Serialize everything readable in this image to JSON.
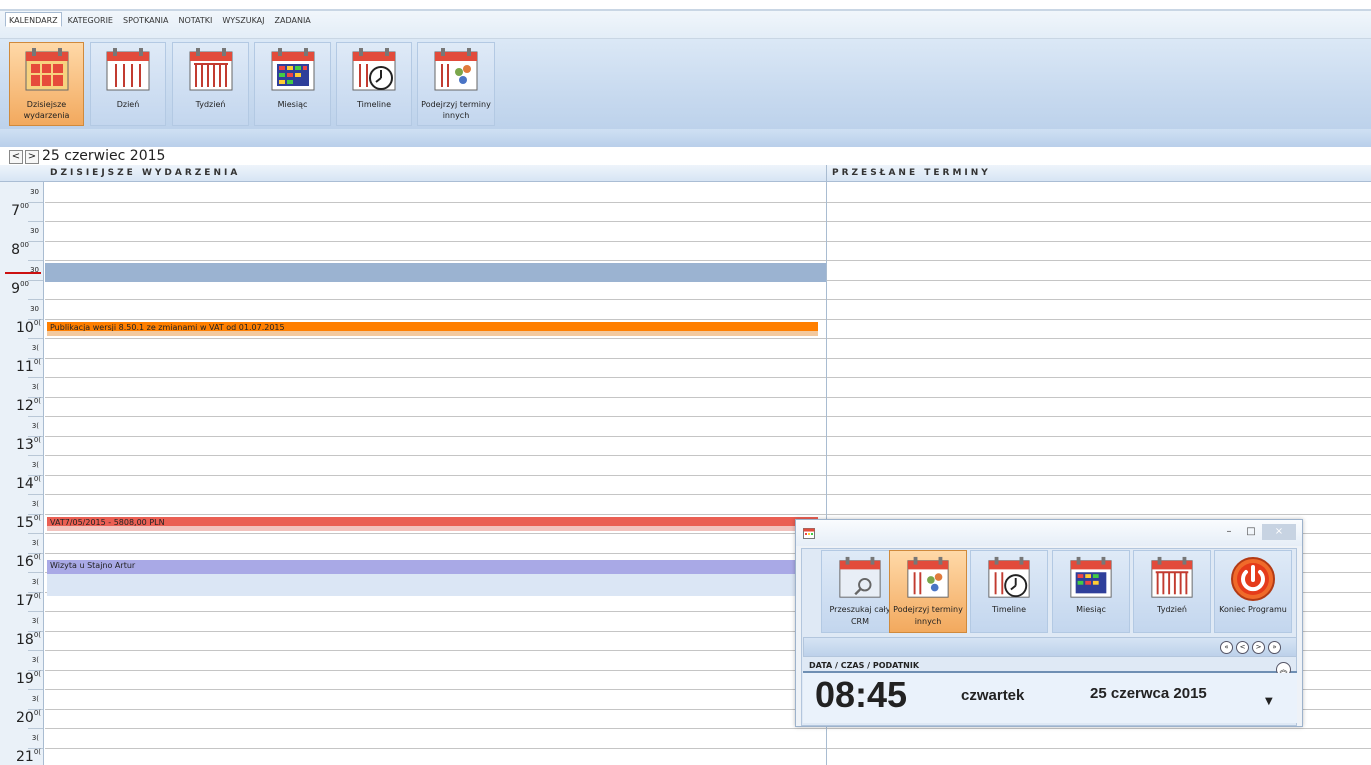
{
  "tabs": [
    "KALENDARZ",
    "KATEGORIE",
    "SPOTKANIA",
    "NOTATKI",
    "WYSZUKAJ",
    "ZADANIA"
  ],
  "ribbon": [
    {
      "label": "Dzisiejsze wydarzenia",
      "icon": "today-events-icon"
    },
    {
      "label": "Dzień",
      "icon": "day-view-icon"
    },
    {
      "label": "Tydzień",
      "icon": "week-view-icon"
    },
    {
      "label": "Miesiąc",
      "icon": "month-view-icon"
    },
    {
      "label": "Timeline",
      "icon": "timeline-icon"
    },
    {
      "label": "Podejrzyj terminy innych",
      "icon": "others-schedule-icon"
    }
  ],
  "nav": {
    "prev": "<",
    "next": ">",
    "date": "25 czerwiec 2015"
  },
  "columns": {
    "left": "DZISIEJSZE WYDARZENIA",
    "right": "PRZESŁANE TERMINY"
  },
  "times": {
    "first_half": "30",
    "hours": [
      "7",
      "8",
      "9",
      "10",
      "11",
      "12",
      "13",
      "14",
      "15",
      "16",
      "17",
      "18",
      "19",
      "20",
      "21"
    ],
    "hour_sup_early": "00",
    "hour_sup_late": "0(",
    "half_early": "30",
    "half_late": "3("
  },
  "events": [
    {
      "title": "",
      "color": "#9bb3d1"
    },
    {
      "title": "Publikacja wersji 8.50.1 ze zmianami w VAT od 01.07.2015",
      "color": "#ff7f00"
    },
    {
      "title": "VAT7/05/2015 - 5808,00 PLN",
      "color": "#ea5f53"
    },
    {
      "title": "Wizyta u Stajno Artur",
      "color": "#a9a9e6"
    }
  ],
  "widget": {
    "buttons": [
      {
        "label": "Przeszukaj cały CRM",
        "icon": "search-crm-icon"
      },
      {
        "label": "Podejrzyj terminy innych",
        "icon": "others-schedule-icon"
      },
      {
        "label": "Timeline",
        "icon": "timeline-icon"
      },
      {
        "label": "Miesiąc",
        "icon": "month-view-icon"
      },
      {
        "label": "Tydzień",
        "icon": "week-view-icon"
      },
      {
        "label": "Koniec Programu",
        "icon": "power-icon"
      }
    ],
    "nav_buttons": [
      "«",
      "<",
      ">",
      "»"
    ],
    "section_title": "DATA / CZAS / PODATNIK",
    "time": "08:45",
    "day": "czwartek",
    "date": "25 czerwca 2015",
    "window_controls": [
      "–",
      "□",
      "×"
    ]
  },
  "colors": {
    "accent_orange": "#ff7f00",
    "event_red": "#ea5f53",
    "event_lavender": "#a9a9e6",
    "current_time": "#cc1111"
  }
}
